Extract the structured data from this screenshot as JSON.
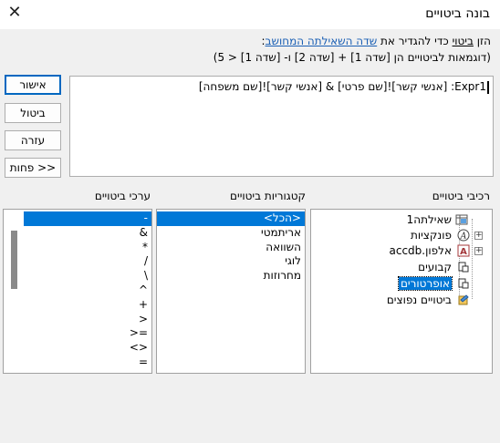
{
  "window": {
    "title": "בונה ביטויים",
    "close_glyph": "✕"
  },
  "instructions": {
    "line1_prefix": "הזן ",
    "line1_underlined": "ביטוי",
    "line1_mid": " כדי להגדיר את ",
    "line1_link": "שדה השאילתה המחושב",
    "line1_end": ":",
    "line2": "(דוגמאות לביטויים הן [שדה 1] + [שדה 2] ו- [שדה 1] < 5)"
  },
  "expression": {
    "value": "Expr1: [אנשי קשר]![שם פרטי] & [אנשי קשר]![שם משפחה]"
  },
  "buttons": {
    "ok": "אישור",
    "cancel": "ביטול",
    "help": "עזרה",
    "less": "<< פחות"
  },
  "labels": {
    "elements": "רכיבי ביטויים",
    "categories": "קטגוריות ביטויים",
    "values": "ערכי ביטויים"
  },
  "tree": {
    "items": [
      {
        "label": "שאילתה1",
        "icon": "query-icon",
        "selected": false
      },
      {
        "label": "פונקציות",
        "icon": "functions-icon",
        "selected": false
      },
      {
        "label": "אלפון.accdb",
        "icon": "database-icon",
        "selected": false
      },
      {
        "label": "קבועים",
        "icon": "constants-icon",
        "selected": false
      },
      {
        "label": "אופרטורים",
        "icon": "operators-icon",
        "selected": true
      },
      {
        "label": "ביטויים נפוצים",
        "icon": "common-expressions-icon",
        "selected": false
      }
    ]
  },
  "categories": {
    "items": [
      "<הכל>",
      "אריתמטי",
      "השוואה",
      "לוגי",
      "מחרוזות"
    ],
    "selected_index": 0
  },
  "values": {
    "items": [
      "-",
      "&",
      "*",
      "/",
      "\\",
      "^",
      "+",
      "<",
      "=<",
      "<>",
      "="
    ],
    "selected_index": 0
  },
  "colors": {
    "selection": "#0078d7",
    "link": "#1a5fb4"
  }
}
